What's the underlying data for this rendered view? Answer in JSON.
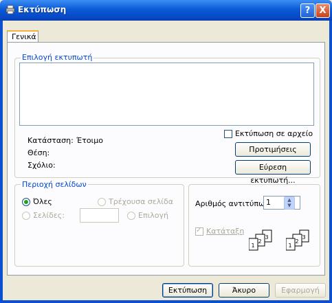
{
  "window": {
    "title": "Εκτύπωση",
    "help_label": "?",
    "close_label": "X"
  },
  "tabs": [
    {
      "label": "Γενικά",
      "active": true
    }
  ],
  "printer_select": {
    "legend": "Επιλογή εκτυπωτή",
    "print_to_file_label": "Εκτύπωση σε αρχείο",
    "print_to_file_checked": false,
    "status_label": "Κατάσταση:",
    "status_value": "Έτοιμο",
    "location_label": "Θέση:",
    "comment_label": "Σχόλιο:",
    "preferences_button": "Προτιμήσεις",
    "find_printer_button": "Εύρεση εκτυπωτή..."
  },
  "page_range": {
    "legend": "Περιοχή σελίδων",
    "all_label": "Όλες",
    "current_page_label": "Τρέχουσα σελίδα",
    "pages_label": "Σελίδες:",
    "selection_label": "Επιλογή",
    "selected": "all"
  },
  "copies": {
    "number_label": "Αριθμός αντιτύπων",
    "number_value": "1",
    "collate_label": "Κατάταξη",
    "collate_checked": true,
    "collate_icon_numbers": [
      "1",
      "2",
      "3"
    ]
  },
  "footer": {
    "print_button": "Εκτύπωση",
    "cancel_button": "Άκυρο",
    "apply_button": "Εφαρμογή"
  },
  "colors": {
    "title_bar": "#0a5bd6",
    "legend_text": "#0046d5",
    "dialog_bg": "#ece9d8",
    "radio_selected": "#21a121"
  }
}
